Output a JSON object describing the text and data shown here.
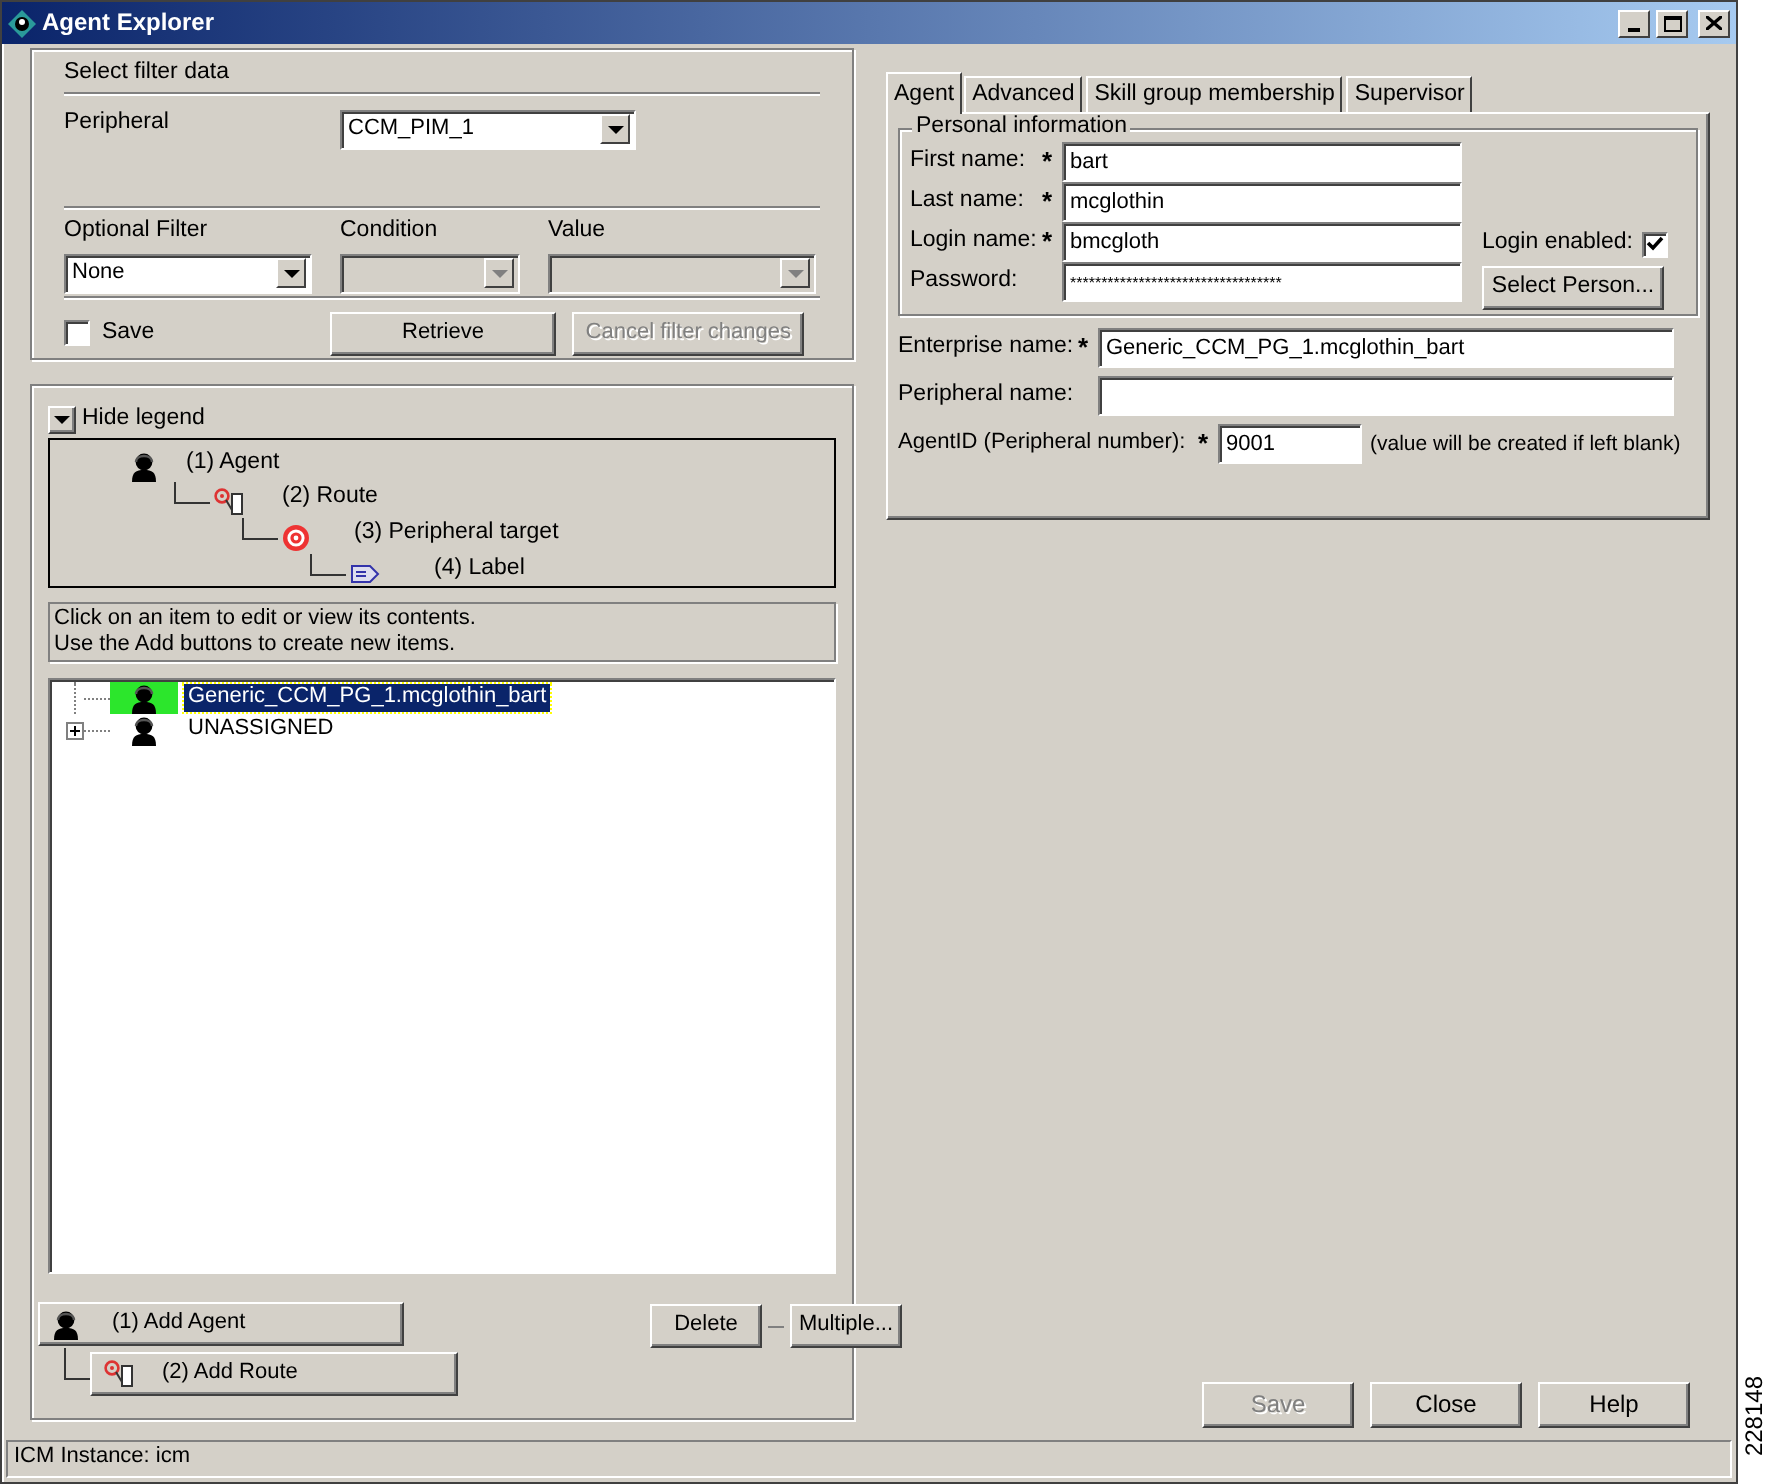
{
  "window": {
    "title": "Agent Explorer"
  },
  "filter": {
    "title": "Select filter data",
    "peripheral": {
      "label": "Peripheral",
      "value": "CCM_PIM_1",
      "disabled": false
    },
    "optional_filter": {
      "label": "Optional Filter",
      "value": "None",
      "disabled": false
    },
    "condition": {
      "label": "Condition",
      "disabled": true
    },
    "value_filter": {
      "label": "Value",
      "disabled": true
    },
    "save": {
      "label": "Save",
      "checked": false
    },
    "buttons": [
      {
        "label": "Retrieve",
        "disabled": false
      },
      {
        "label": "Cancel filter changes",
        "disabled": true
      }
    ]
  },
  "legend": {
    "toggle": "Hide legend",
    "items": [
      {
        "kind": "agent",
        "label": "(1) Agent",
        "children": [
          {
            "kind": "route",
            "label": "(2) Route",
            "children": [
              {
                "kind": "target",
                "label": "(3) Peripheral target",
                "children": [
                  {
                    "kind": "label",
                    "label": "(4) Label"
                  }
                ]
              }
            ]
          }
        ]
      }
    ]
  },
  "hint": [
    "Click on an item to edit or view its contents.",
    "Use the Add buttons to create new items."
  ],
  "tree": [
    {
      "label": "Generic_CCM_PG_1.mcglothin_bart",
      "selected": true,
      "has_children": false
    },
    {
      "label": "UNASSIGNED",
      "selected": false,
      "has_children": true,
      "expanded": false
    }
  ],
  "add_buttons": [
    {
      "kind": "agent",
      "label": "(1) Add Agent"
    },
    {
      "kind": "route",
      "label": "(2) Add Route"
    }
  ],
  "delete_button": "Delete",
  "multiple_button": "Multiple...",
  "tabs": [
    {
      "label": "Agent",
      "selected": true
    },
    {
      "label": "Advanced",
      "selected": false
    },
    {
      "label": "Skill group membership",
      "selected": false
    },
    {
      "label": "Supervisor",
      "selected": false
    }
  ],
  "personal_info": {
    "title": "Personal information",
    "fields": [
      {
        "label": "First name:",
        "mark": "*",
        "value": "bart"
      },
      {
        "label": "Last name:",
        "mark": "*",
        "value": "mcglothin"
      },
      {
        "label": "Login name:",
        "mark": "*",
        "value": "bmcgloth"
      },
      {
        "label": "Password:",
        "value": "**********************************"
      }
    ],
    "login_enabled": {
      "label": "Login enabled:",
      "checked": true
    },
    "select_person": "Select Person..."
  },
  "enterprise_name": {
    "label": "Enterprise name:",
    "mark": "*",
    "value": "Generic_CCM_PG_1.mcglothin_bart"
  },
  "peripheral_name": {
    "label": "Peripheral name:"
  },
  "agent_id": {
    "label": "AgentID (Peripheral number):",
    "mark": "*",
    "value": "9001",
    "note": "(value will be created if left blank)"
  },
  "footer_buttons": [
    {
      "label": "Save",
      "disabled": true
    },
    {
      "label": "Close",
      "disabled": false
    },
    {
      "label": "Help",
      "disabled": false
    }
  ],
  "status_bar": "ICM Instance: icm",
  "figure_id": "228148"
}
